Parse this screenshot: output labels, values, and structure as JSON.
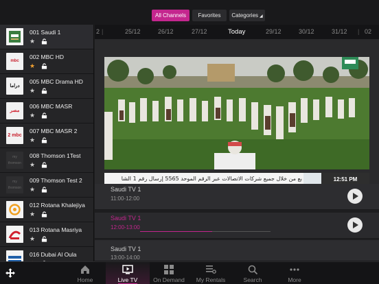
{
  "filters": {
    "all": "All Channels",
    "favorites": "Favorites",
    "categories": "Categories"
  },
  "channels": [
    {
      "name": "001 Saudi 1",
      "logo": "",
      "favorite": false
    },
    {
      "name": "002 MBC HD",
      "logo": "mbc",
      "favorite": true
    },
    {
      "name": "005 MBC Drama HD",
      "logo": "دراما",
      "favorite": false
    },
    {
      "name": "006 MBC MASR",
      "logo": "مصر",
      "favorite": false
    },
    {
      "name": "007 MBC MASR 2",
      "logo": "2 mbc",
      "favorite": false
    },
    {
      "name": "008 Thomson 1Test",
      "logo": "my thomson",
      "favorite": false
    },
    {
      "name": "009 Thomson Test  2",
      "logo": "my thomson",
      "favorite": false
    },
    {
      "name": "012 Rotana Khalejiya",
      "logo": "",
      "favorite": false
    },
    {
      "name": "013 Rotana Masriya",
      "logo": "",
      "favorite": false
    },
    {
      "name": "016 Dubai Al Oula",
      "logo": "",
      "favorite": true
    }
  ],
  "dates": {
    "items": [
      "25/12",
      "26/12",
      "27/12",
      "Today",
      "29/12",
      "30/12",
      "31/12"
    ],
    "prev_partial": "2",
    "next_partial": "02"
  },
  "player": {
    "ticker_text": "بع من خلال جميع شركات الاتصالات عبر الرقم الموحد 5565 إرسال رقم 1 الشا",
    "clock": "12:51 PM",
    "progress": 0.55
  },
  "programmes": [
    {
      "title": "Saudi TV 1",
      "time": "11:00-12:00",
      "current": false
    },
    {
      "title": "Saudi TV 1",
      "time": "12:00-13:00",
      "current": true
    },
    {
      "title": "Saudi TV 1",
      "time": "13:00-14:00",
      "current": false
    }
  ],
  "tabs": [
    {
      "label": "Home",
      "icon": "home-icon"
    },
    {
      "label": "Live TV",
      "icon": "tv-icon"
    },
    {
      "label": "On Demand",
      "icon": "grid-icon"
    },
    {
      "label": "My Rentals",
      "icon": "list-icon"
    },
    {
      "label": "Search",
      "icon": "search-icon"
    },
    {
      "label": "More",
      "icon": "more-icon"
    }
  ],
  "colors": {
    "accent": "#c4268e",
    "favorite": "#f0a030"
  }
}
